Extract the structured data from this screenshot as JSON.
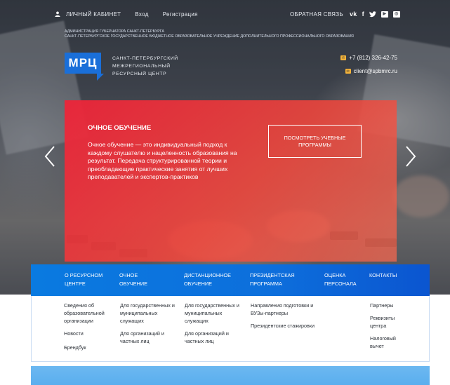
{
  "topbar": {
    "cabinet": "ЛИЧНЫЙ КАБИНЕТ",
    "login": "Вход",
    "register": "Регистрация",
    "feedback": "ОБРАТНАЯ СВЯЗЬ",
    "social_icons": [
      "vk-icon",
      "facebook-icon",
      "twitter-icon",
      "youtube-icon",
      "instagram-icon"
    ]
  },
  "gov": {
    "line1": "АДМИНИСТРАЦИЯ ГУБЕРНАТОРА САНКТ-ПЕТЕРБУРГА",
    "line2": "САНКТ-ПЕТЕРБУРГСКОЕ ГОСУДАРСТВЕННОЕ БЮДЖЕТНОЕ ОБРАЗОВАТЕЛЬНОЕ УЧРЕЖДЕНИЕ ДОПОЛНИТЕЛЬНОГО ПРОФЕССИОНАЛЬНОГО ОБРАЗОВАНИЯ"
  },
  "logo": {
    "abbr": "МРЦ",
    "line1": "САНКТ-ПЕТЕРБУРГСКИЙ",
    "line2": "МЕЖРЕГИОНАЛЬНЫЙ",
    "line3": "РЕСУРСНЫЙ ЦЕНТР"
  },
  "contacts": {
    "phone": "+7 (812) 326-42-75",
    "email": "client@spbmrc.ru"
  },
  "promo": {
    "title": "ОЧНОЕ ОБУЧЕНИЕ",
    "text": "Очное обучение — это индивидуальный подход к каждому слушателю и нацеленность образования на результат. Передача структурированной теории и преобладающие практические занятия от лучших преподавателей и экспертов-практиков",
    "button": "ПОСМОТРЕТЬ УЧЕБНЫЕ ПРОГРАММЫ"
  },
  "nav": {
    "items": [
      {
        "line1": "О РЕСУРСНОМ",
        "line2": "ЦЕНТРЕ"
      },
      {
        "line1": "ОЧНОЕ",
        "line2": "ОБУЧЕНИЕ"
      },
      {
        "line1": "ДИСТАНЦИОННОЕ",
        "line2": "ОБУЧЕНИЕ"
      },
      {
        "line1": "ПРЕЗИДЕНТСКАЯ",
        "line2": "ПРОГРАММА"
      },
      {
        "line1": "ОЦЕНКА",
        "line2": "ПЕРСОНАЛА"
      },
      {
        "line1": "КОНТАКТЫ",
        "line2": ""
      }
    ]
  },
  "dropdown": {
    "col1": [
      "Сведения об образовательной организации",
      "Новости",
      "Брендбук"
    ],
    "col2": [
      "Для государственных и муниципальных служащих",
      "Для организаций и частных лиц"
    ],
    "col3": [
      "Для государственных и муниципальных служащих",
      "Для организаций и частных лиц"
    ],
    "col4": [
      "Направления подготовки и ВУЗы-партнеры",
      "Президентские стажировки"
    ],
    "col6": [
      "Партнеры",
      "Реквизиты центра",
      "Налоговый вычет"
    ]
  },
  "colors": {
    "nav_blue": "#0a7ae0",
    "promo_red": "#ed2339",
    "accent_yellow": "#f4b33a",
    "band_blue": "#6cb8f1"
  }
}
